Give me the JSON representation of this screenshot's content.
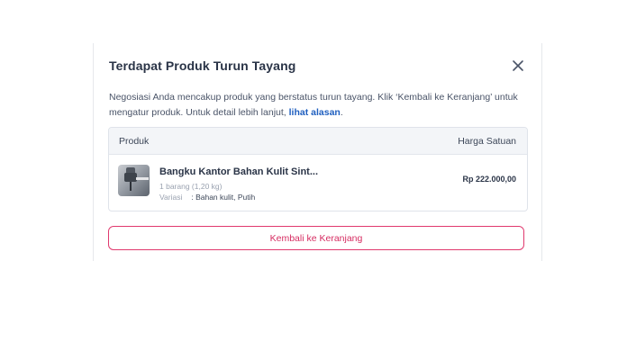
{
  "modal": {
    "title": "Terdapat Produk Turun Tayang",
    "description_pre": "Negosiasi Anda mencakup produk yang berstatus turun tayang. Klik ‘Kembali ke Keranjang’ untuk mengatur produk. Untuk detail lebih lanjut, ",
    "description_link": "lihat alasan",
    "description_post": "."
  },
  "table": {
    "headers": {
      "product": "Produk",
      "unit_price": "Harga Satuan"
    },
    "rows": [
      {
        "name": "Bangku Kantor Bahan Kulit Sint...",
        "quantity": "1 barang (1,20 kg)",
        "variant_label": "Variasi",
        "variant_value": ": Bahan kulit, Putih",
        "price": "Rp 222.000,00"
      }
    ]
  },
  "actions": {
    "back_to_cart": "Kembali ke Keranjang"
  },
  "icons": {
    "close": "close-icon",
    "product": "office-chair-thumbnail"
  },
  "colors": {
    "accent": "#e0396e",
    "link": "#1f5fbf",
    "title": "#2a3447"
  }
}
